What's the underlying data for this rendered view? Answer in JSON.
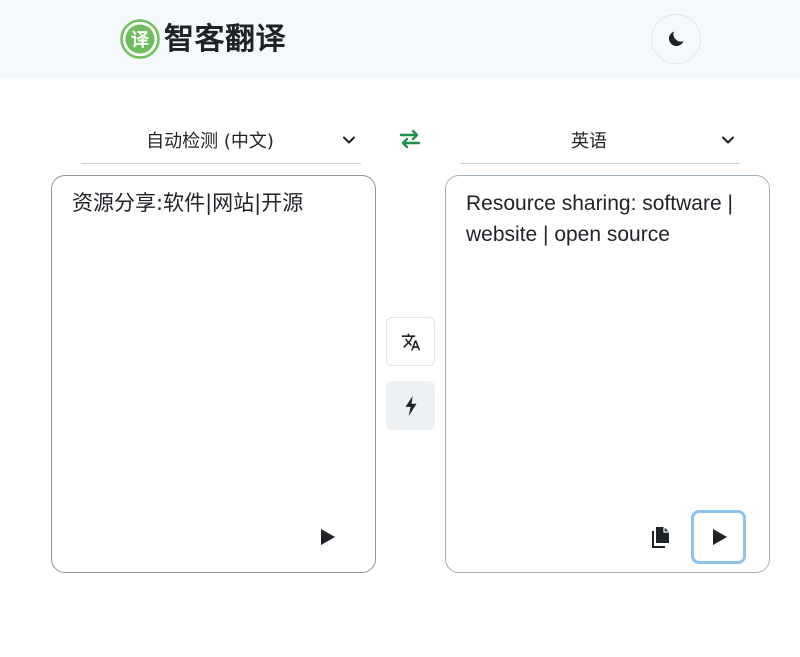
{
  "app": {
    "brand": "智客翻译",
    "logo_glyph": "译",
    "logo_color": "#6cbf5a",
    "theme_icon": "moon-icon"
  },
  "languages": {
    "source": "自动检测 (中文)",
    "target": "英语"
  },
  "source_panel": {
    "text": "资源分享:软件|网站|开源"
  },
  "target_panel": {
    "text": "Resource sharing: software | website | open source"
  },
  "colors": {
    "accent_green": "#1f8f4e",
    "focus_blue": "#8dc2ea"
  }
}
